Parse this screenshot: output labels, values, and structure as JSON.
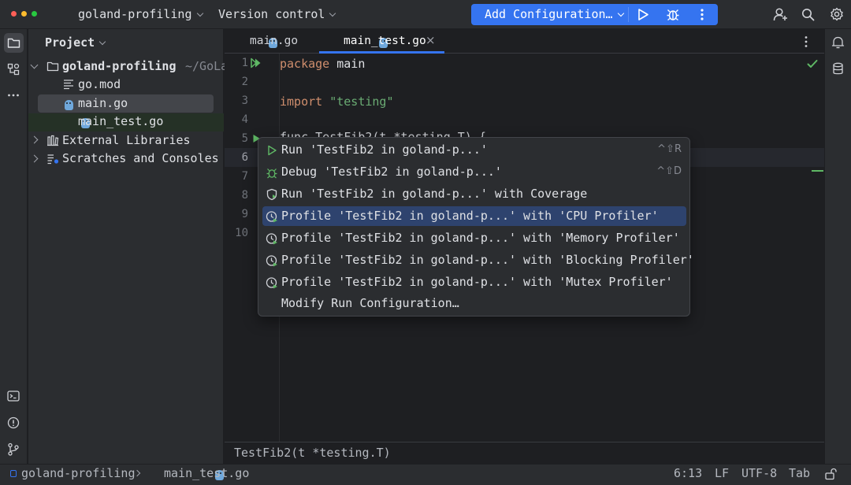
{
  "titlebar": {
    "project_name": "goland-profiling",
    "vcs_label": "Version control",
    "run_config_label": "Add Configuration…"
  },
  "project_panel": {
    "title": "Project",
    "root": {
      "name": "goland-profiling",
      "path": "~/GoLa"
    },
    "files": [
      "go.mod",
      "main.go",
      "main_test.go"
    ],
    "external_libraries": "External Libraries",
    "scratches": "Scratches and Consoles"
  },
  "tabs": [
    {
      "label": "main.go",
      "active": false
    },
    {
      "label": "main_test.go",
      "active": true
    }
  ],
  "editor": {
    "line_numbers": [
      "1",
      "2",
      "3",
      "4",
      "5",
      "6",
      "7",
      "8",
      "9",
      "10"
    ],
    "code": {
      "line1_kw": "package",
      "line1_rest": " main",
      "line3_kw": "import",
      "line3_str": " \"testing\"",
      "line5_partial": "func TestFib2(t *testing.T) {"
    },
    "breadcrumb": "TestFib2(t *testing.T)"
  },
  "popup": {
    "items": [
      {
        "label": "Run 'TestFib2 in goland-p...'",
        "shortcut": "^⇧R",
        "icon": "run-icon"
      },
      {
        "label": "Debug 'TestFib2 in goland-p...'",
        "shortcut": "^⇧D",
        "icon": "debug-icon"
      },
      {
        "label": "Run 'TestFib2 in goland-p...' with Coverage",
        "shortcut": "",
        "icon": "coverage-icon"
      },
      {
        "label": "Profile 'TestFib2 in goland-p...' with 'CPU Profiler'",
        "shortcut": "",
        "icon": "profiler-icon",
        "selected": true
      },
      {
        "label": "Profile 'TestFib2 in goland-p...' with 'Memory Profiler'",
        "shortcut": "",
        "icon": "profiler-icon"
      },
      {
        "label": "Profile 'TestFib2 in goland-p...' with 'Blocking Profiler'",
        "shortcut": "",
        "icon": "profiler-icon"
      },
      {
        "label": "Profile 'TestFib2 in goland-p...' with 'Mutex Profiler'",
        "shortcut": "",
        "icon": "profiler-icon"
      },
      {
        "label": "Modify Run Configuration…",
        "shortcut": "",
        "icon": ""
      }
    ]
  },
  "statusbar": {
    "project": "goland-profiling",
    "file": "main_test.go",
    "position": "6:13",
    "line_ending": "LF",
    "encoding": "UTF-8",
    "indent": "Tab"
  },
  "colors": {
    "accent": "#3574f0",
    "selection": "#2e436e",
    "keyword": "#cf8e6d",
    "string": "#6aab73",
    "run_green": "#5fb865"
  }
}
